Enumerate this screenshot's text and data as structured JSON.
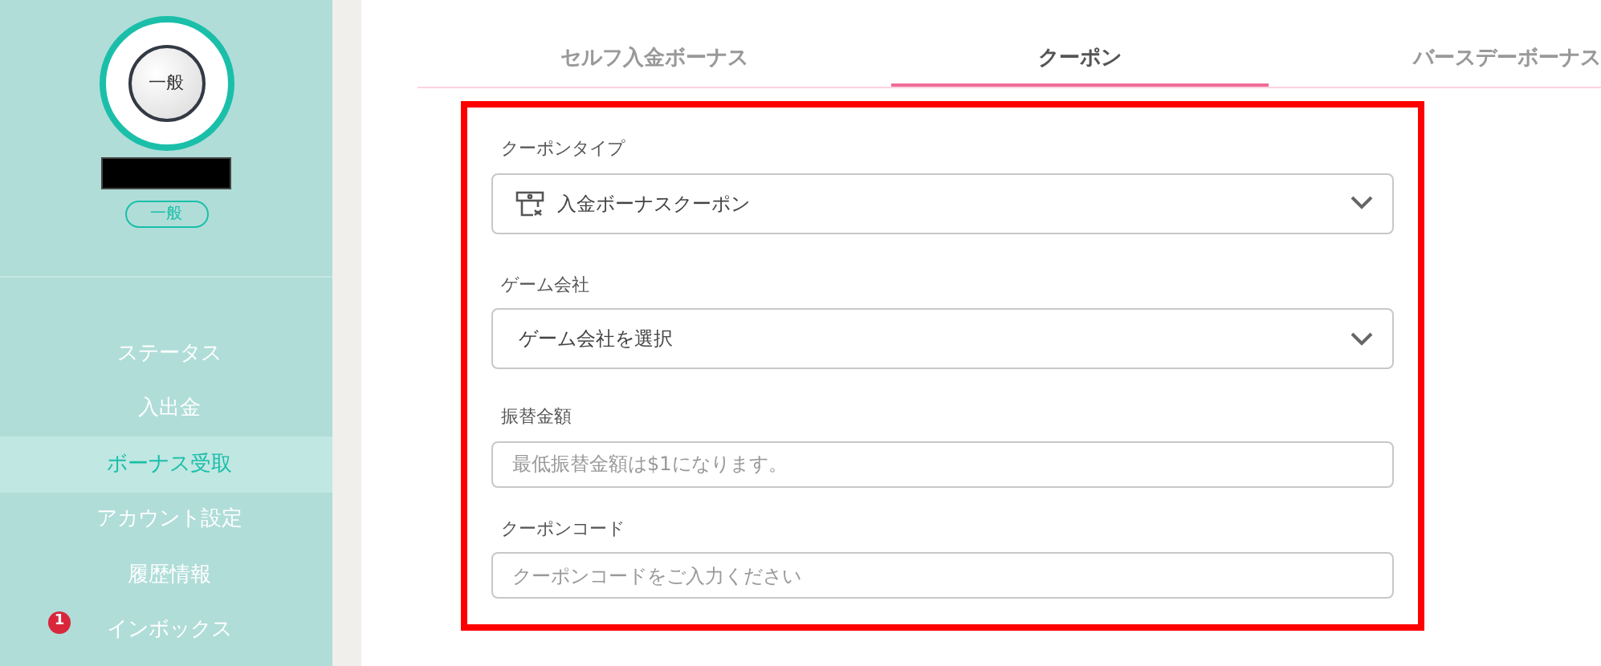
{
  "profile": {
    "avatar_label": "一般",
    "rank_badge": "一般"
  },
  "sidebar": {
    "items": [
      {
        "label": "ステータス",
        "selected": false
      },
      {
        "label": "入出金",
        "selected": false
      },
      {
        "label": "ボーナス受取",
        "selected": true
      },
      {
        "label": "アカウント設定",
        "selected": false
      },
      {
        "label": "履歴情報",
        "selected": false
      },
      {
        "label": "インボックス",
        "selected": false,
        "badge": "1"
      }
    ]
  },
  "tabs": [
    {
      "label": "セルフ入金ボーナス",
      "selected": false
    },
    {
      "label": "クーポン",
      "selected": true
    },
    {
      "label": "バースデーボーナス",
      "selected": false
    }
  ],
  "form": {
    "fields": [
      {
        "kind": "select",
        "label": "クーポンタイプ",
        "value": "入金ボーナスクーポン",
        "icon": true
      },
      {
        "kind": "select",
        "label": "ゲーム会社",
        "value": "ゲーム会社を選択"
      },
      {
        "kind": "input",
        "label": "振替金額",
        "placeholder": "最低振替金額は$1になります。"
      },
      {
        "kind": "input",
        "label": "クーポンコード",
        "placeholder": "クーポンコードをご入力ください"
      }
    ]
  }
}
